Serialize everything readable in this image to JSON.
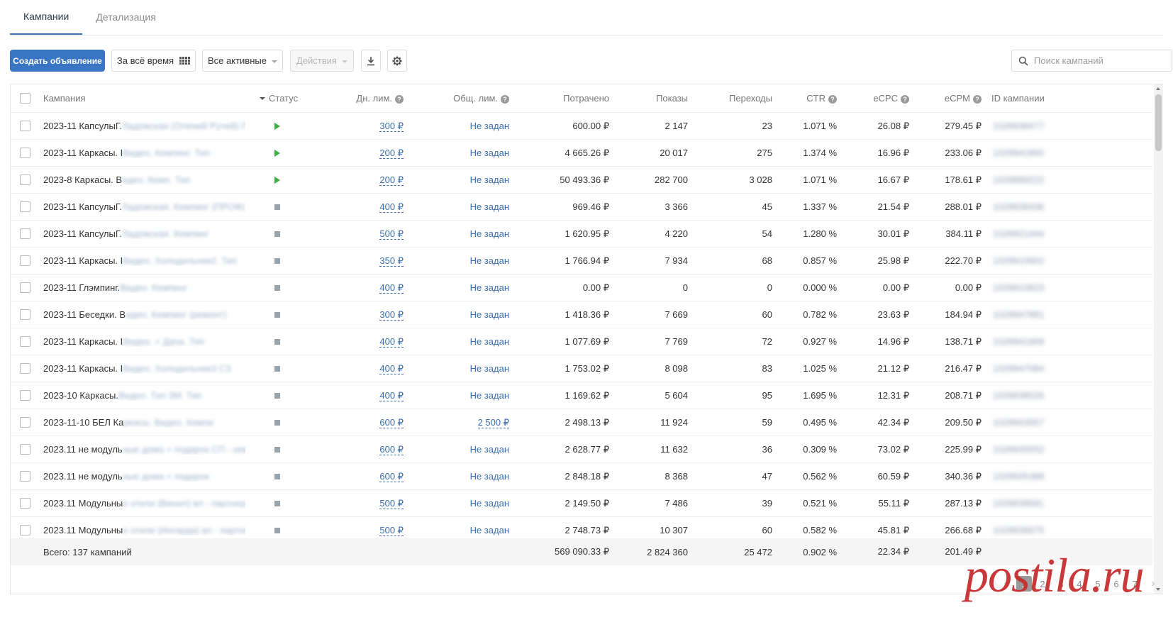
{
  "tabs": [
    "Кампании",
    "Детализация"
  ],
  "toolbar": {
    "create_label": "Создать объявление",
    "period_label": "За всё время",
    "filter_label": "Все активные",
    "actions_label": "Действия",
    "download_icon": "download-icon",
    "settings_icon": "gear-icon",
    "search_placeholder": "Поиск кампаний"
  },
  "table": {
    "headers": {
      "campaign": "Кампания",
      "status": "Статус",
      "daily_limit": "Дн. лим.",
      "total_limit": "Общ. лим.",
      "spent": "Потрачено",
      "impressions": "Показы",
      "clicks": "Переходы",
      "ctr": "CTR",
      "ecpc": "eCPC",
      "ecpm": "eCPM",
      "id": "ID кампании"
    },
    "rows": [
      {
        "name_visible": "2023-11 КапсулыГ.",
        "name_hidden": "Ладожская (Олений Ручей) ПК...",
        "status": "active",
        "daily": "300 ₽",
        "total": "Не задан",
        "spent": "600.00 ₽",
        "impressions": "2 147",
        "clicks": "23",
        "ctr": "1.071 %",
        "ecpc": "26.08 ₽",
        "ecpm": "279.45 ₽",
        "id": "1029938477"
      },
      {
        "name_visible": "2023-11 Каркасы. I",
        "name_hidden": "Видео. Кемпинг. Тип",
        "status": "active",
        "daily": "200 ₽",
        "total": "Не задан",
        "spent": "4 665.26 ₽",
        "impressions": "20 017",
        "clicks": "275",
        "ctr": "1.374 %",
        "ecpc": "16.96 ₽",
        "ecpm": "233.06 ₽",
        "id": "1029941865"
      },
      {
        "name_visible": "2023-8 Каркасы. В",
        "name_hidden": "идео. Кемп. Тип",
        "status": "active",
        "daily": "200 ₽",
        "total": "Не задан",
        "spent": "50 493.36 ₽",
        "impressions": "282 700",
        "clicks": "3 028",
        "ctr": "1.071 %",
        "ecpc": "16.67 ₽",
        "ecpm": "178.61 ₽",
        "id": "1029889222"
      },
      {
        "name_visible": "2023-11 КапсулыГ.",
        "name_hidden": "Ладожская. Кемпинг (ПРОФ)",
        "status": "stopped",
        "daily": "400 ₽",
        "total": "Не задан",
        "spent": "969.46 ₽",
        "impressions": "3 366",
        "clicks": "45",
        "ctr": "1.337 %",
        "ecpc": "21.54 ₽",
        "ecpm": "288.01 ₽",
        "id": "1029938436"
      },
      {
        "name_visible": "2023-11 КапсулыГ.",
        "name_hidden": "Ладожская. Кемпинг",
        "status": "stopped",
        "daily": "500 ₽",
        "total": "Не задан",
        "spent": "1 620.95 ₽",
        "impressions": "4 220",
        "clicks": "54",
        "ctr": "1.280 %",
        "ecpc": "30.01 ₽",
        "ecpm": "384.11 ₽",
        "id": "1029921444"
      },
      {
        "name_visible": "2023-11 Каркасы. I",
        "name_hidden": "Видео. Холодильник2. Тип",
        "status": "stopped",
        "daily": "350 ₽",
        "total": "Не задан",
        "spent": "1 766.94 ₽",
        "impressions": "7 934",
        "clicks": "68",
        "ctr": "0.857 %",
        "ecpc": "25.98 ₽",
        "ecpm": "222.70 ₽",
        "id": "1029915602"
      },
      {
        "name_visible": "2023-11 Глэмпинг.",
        "name_hidden": "Видео. Кемпинг",
        "status": "stopped",
        "daily": "400 ₽",
        "total": "Не задан",
        "spent": "0.00 ₽",
        "impressions": "0",
        "clicks": "0",
        "ctr": "0.000 %",
        "ecpc": "0.00 ₽",
        "ecpm": "0.00 ₽",
        "id": "1029910823"
      },
      {
        "name_visible": "2023-11 Беседки. В",
        "name_hidden": "идео. Кемпинг (ремонт)",
        "status": "stopped",
        "daily": "300 ₽",
        "total": "Не задан",
        "spent": "1 418.36 ₽",
        "impressions": "7 669",
        "clicks": "60",
        "ctr": "0.782 %",
        "ecpc": "23.63 ₽",
        "ecpm": "184.94 ₽",
        "id": "1029947881"
      },
      {
        "name_visible": "2023-11 Каркасы. I",
        "name_hidden": "Видео. + Дача. Тип",
        "status": "stopped",
        "daily": "400 ₽",
        "total": "Не задан",
        "spent": "1 077.69 ₽",
        "impressions": "7 769",
        "clicks": "72",
        "ctr": "0.927 %",
        "ecpc": "14.96 ₽",
        "ecpm": "138.71 ₽",
        "id": "1029941909"
      },
      {
        "name_visible": "2023-11 Каркасы. I",
        "name_hidden": "Видео. Холодильник3 СЗ",
        "status": "stopped",
        "daily": "400 ₽",
        "total": "Не задан",
        "spent": "1 753.02 ₽",
        "impressions": "8 098",
        "clicks": "83",
        "ctr": "1.025 %",
        "ecpc": "21.12 ₽",
        "ecpm": "216.47 ₽",
        "id": "1029947084"
      },
      {
        "name_visible": "2023-10 Каркасы.",
        "name_hidden": "Видео. Тип 3М. Тип",
        "status": "stopped",
        "daily": "400 ₽",
        "total": "Не задан",
        "spent": "1 169.62 ₽",
        "impressions": "5 604",
        "clicks": "95",
        "ctr": "1.695 %",
        "ecpc": "12.31 ₽",
        "ecpm": "208.71 ₽",
        "id": "1029938026"
      },
      {
        "name_visible": "2023-11-10 БЕЛ Ка",
        "name_hidden": "ркасы. Видео. Кемпи",
        "status": "stopped",
        "daily": "600 ₽",
        "total": "2 500 ₽",
        "spent": "2 498.13 ₽",
        "impressions": "11 924",
        "clicks": "59",
        "ctr": "0.495 %",
        "ecpc": "42.34 ₽",
        "ecpm": "209.50 ₽",
        "id": "1029943957"
      },
      {
        "name_visible": "2023.11 не модуль",
        "name_hidden": "ные дома + подарок СП - кем...",
        "status": "stopped",
        "daily": "600 ₽",
        "total": "Не задан",
        "spent": "2 628.77 ₽",
        "impressions": "11 632",
        "clicks": "36",
        "ctr": "0.309 %",
        "ecpc": "73.02 ₽",
        "ecpm": "225.99 ₽",
        "id": "1029935552"
      },
      {
        "name_visible": "2023.11 не модуль",
        "name_hidden": "ные дома + подарок",
        "status": "stopped",
        "daily": "600 ₽",
        "total": "Не задан",
        "spent": "2 848.18 ₽",
        "impressions": "8 368",
        "clicks": "47",
        "ctr": "0.562 %",
        "ecpc": "60.59 ₽",
        "ecpm": "340.36 ₽",
        "id": "1029935388"
      },
      {
        "name_visible": "2023.11 Модульны",
        "name_hidden": "е отели (Винил) вл - партнеры",
        "status": "stopped",
        "daily": "500 ₽",
        "total": "Не задан",
        "spent": "2 149.50 ₽",
        "impressions": "7 486",
        "clicks": "39",
        "ctr": "0.521 %",
        "ecpc": "55.11 ₽",
        "ecpm": "287.13 ₽",
        "id": "1029938691"
      },
      {
        "name_visible": "2023.11 Модульны",
        "name_hidden": "е отели (Ингарда) вл - партнеры",
        "status": "stopped",
        "daily": "500 ₽",
        "total": "Не задан",
        "spent": "2 748.73 ₽",
        "impressions": "10 307",
        "clicks": "60",
        "ctr": "0.582 %",
        "ecpc": "45.81 ₽",
        "ecpm": "266.68 ₽",
        "id": "1029938675"
      }
    ],
    "footer": {
      "label": "Всего: 137 кампаний",
      "spent": "569 090.33 ₽",
      "impressions": "2 824 360",
      "clicks": "25 472",
      "ctr": "0.902 %",
      "ecpc": "22.34 ₽",
      "ecpm": "201.49 ₽"
    }
  },
  "pagination": {
    "prev": "‹",
    "pages": [
      "1",
      "2",
      "3",
      "4",
      "5",
      "6",
      "7"
    ],
    "next": "›",
    "current": "1"
  },
  "watermark": "Postila.ru",
  "colors": {
    "primary": "#3a75c4",
    "active_status": "#3cb043",
    "stopped_status": "#9aa4ad",
    "link": "#3a6fae",
    "watermark": "#c62b2b"
  }
}
